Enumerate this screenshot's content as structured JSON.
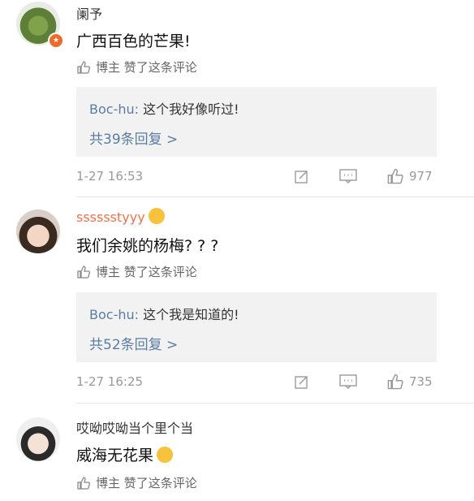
{
  "comments": [
    {
      "username": "阑予",
      "text": "广西百色的芒果!",
      "like_label": "博主 赞了这条评论",
      "reply": {
        "author": "Boc-hu:",
        "text": "这个我好像听过!",
        "more": "共39条回复 >"
      },
      "time": "1-27 16:53",
      "likes": "977"
    },
    {
      "username": "sssssstyyy",
      "text": "我们余姚的杨梅? ? ?",
      "like_label": "博主 赞了这条评论",
      "reply": {
        "author": "Boc-hu:",
        "text": "这个我是知道的!",
        "more": "共52条回复 >"
      },
      "time": "1-27 16:25",
      "likes": "735"
    },
    {
      "username": "哎呦哎呦当个里个当",
      "text": "威海无花果",
      "like_label": "博主 赞了这条评论"
    }
  ],
  "icons": {
    "repost": "repost-icon",
    "comment": "comment-icon",
    "like": "thumbs-up-icon"
  },
  "colors": {
    "reply_author": "#5b7da3",
    "vip_name": "#eb7350",
    "reply_bg": "#f2f2f2"
  }
}
